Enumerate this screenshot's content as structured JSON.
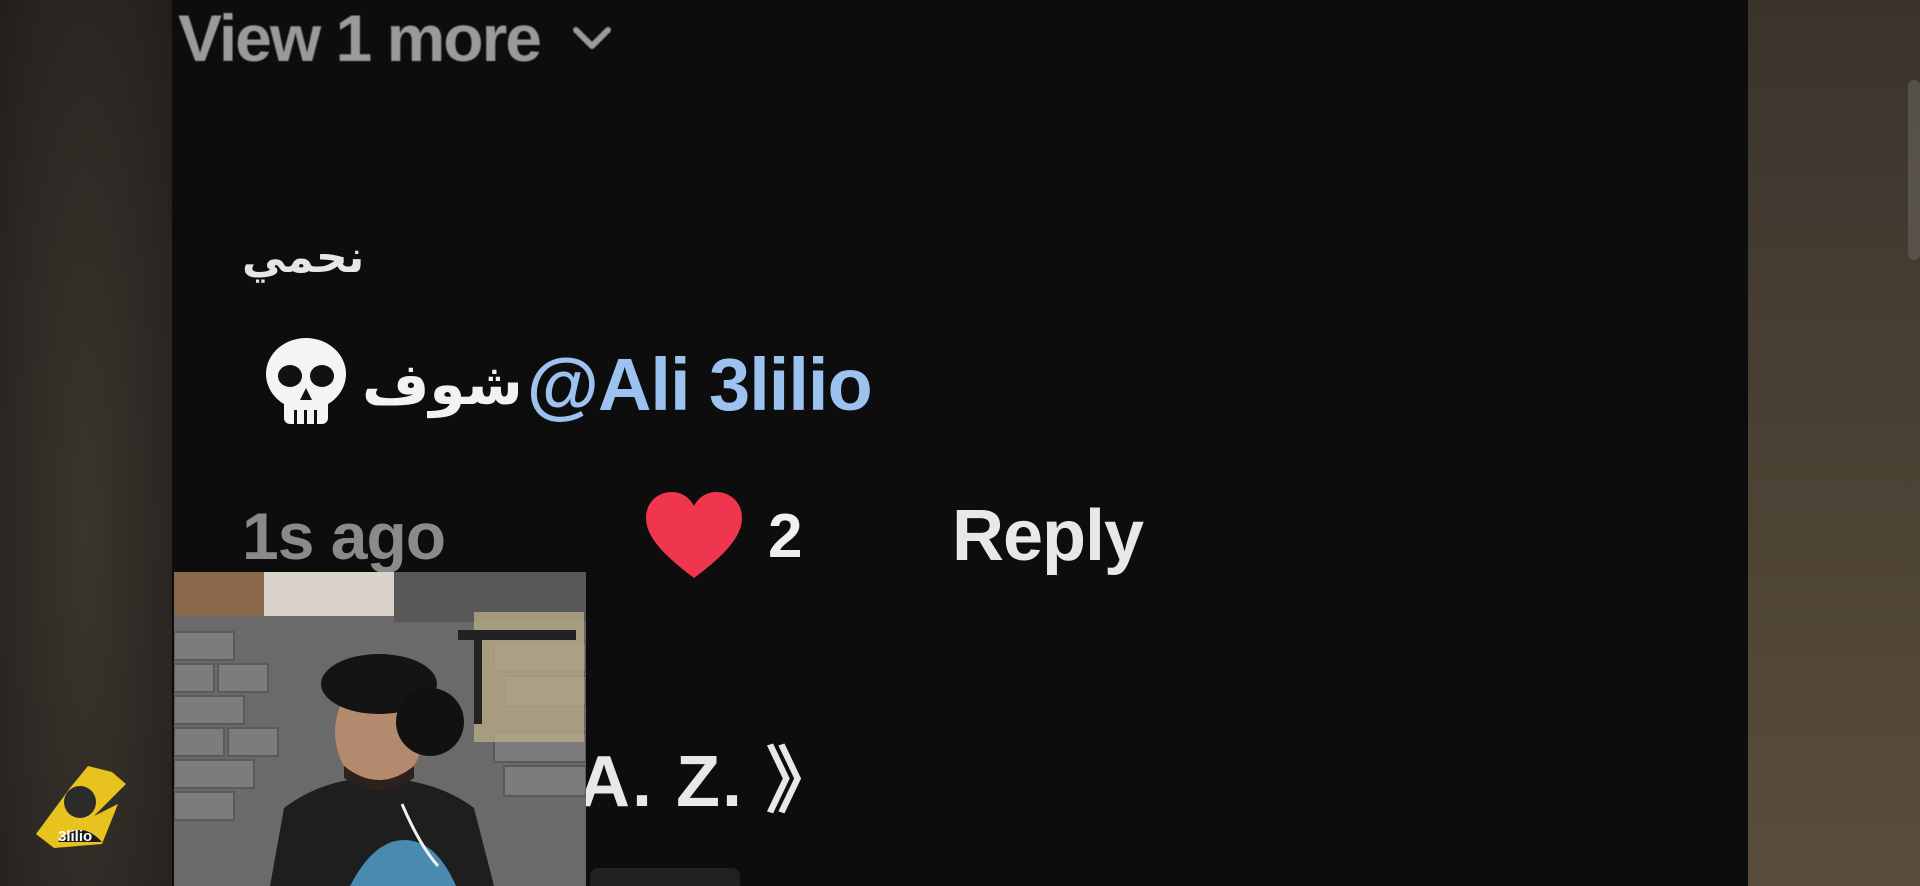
{
  "thread": {
    "view_more_label": "View 1 more",
    "view_more_icon": "chevron-down-icon"
  },
  "comment": {
    "username": "نحمي",
    "body_emoji": "skull-emoji",
    "body_arabic": "شوف",
    "mention": "@Ali 3lilio",
    "time_ago": "1s ago",
    "like_icon": "heart-icon",
    "like_color": "#f0354f",
    "like_count": "2",
    "reply_label": "Reply",
    "mention_color": "#9cc3f0"
  },
  "next_comment": {
    "username_partial": "A. Z. 》"
  },
  "overlay": {
    "webcam_label": "webcam-feed",
    "logo_text": "3lilio"
  }
}
